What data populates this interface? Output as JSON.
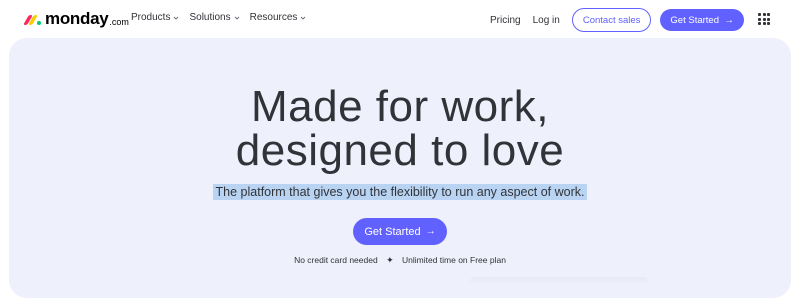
{
  "brand": {
    "name": "monday",
    "suffix": ".com",
    "colors": [
      "#fb275d",
      "#ffcb00",
      "#00ca72"
    ]
  },
  "nav": {
    "items": [
      {
        "label": "Products"
      },
      {
        "label": "Solutions"
      },
      {
        "label": "Resources"
      }
    ]
  },
  "header_right": {
    "pricing": "Pricing",
    "login": "Log in",
    "contact": "Contact sales",
    "get_started": "Get Started",
    "apps_icon": "grid-icon"
  },
  "hero": {
    "headline_line1": "Made for work,",
    "headline_line2": "designed to love",
    "subtitle": "The platform that gives you the flexibility to run any aspect of work.",
    "cta": "Get Started",
    "note_left": "No credit card needed",
    "note_separator": "✦",
    "note_right": "Unlimited time on Free plan"
  },
  "colors": {
    "accent": "#6161ff",
    "hero_bg": "#eef0fb",
    "highlight": "#b9d4f3"
  }
}
